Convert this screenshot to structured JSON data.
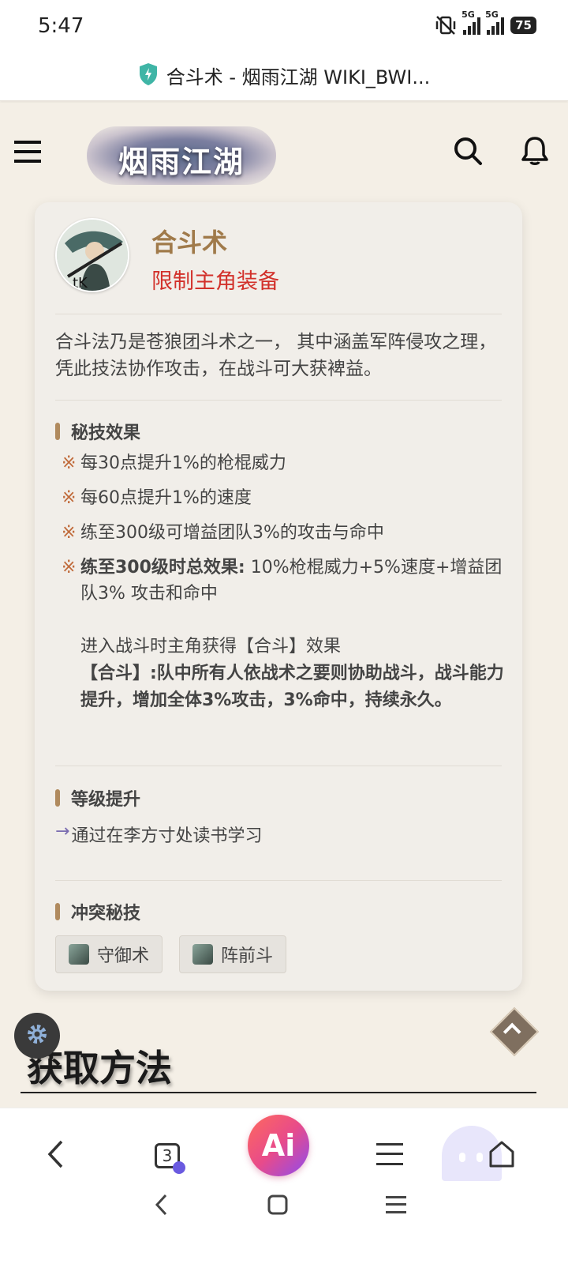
{
  "status_bar": {
    "time": "5:47",
    "net1": "5G",
    "net2": "5G",
    "battery": "75"
  },
  "url_bar": {
    "title": "合斗术 - 烟雨江湖 WIKI_BWI..."
  },
  "header": {
    "logo_text": "烟雨江湖"
  },
  "card": {
    "title": "合斗术",
    "restriction": "限制主角装备",
    "avatar_caption": "tK",
    "description": "合斗法乃是苍狼团斗术之一， 其中涵盖军阵侵攻之理，凭此技法协作攻击，在战斗可大获裨益。",
    "effects_heading": "秘技效果",
    "mark": "※",
    "effects": [
      "每30点提升1%的枪棍威力",
      "每60点提升1%的速度",
      "练至300级可增益团队3%的攻击与命中"
    ],
    "total_effect_label": "练至300级时总效果:",
    "total_effect_value": " 10%枪棍威力+5%速度+增益团队3% 攻击和命中",
    "battle_note": "进入战斗时主角获得【合斗】效果",
    "heji_bold": "【合斗】:队中所有人依战术之要则协助战斗，战斗能力提升，增加全体3%攻击，3%命中，持续永久。",
    "level_heading": "等级提升",
    "arrow": "→",
    "level_text": "通过在李方寸处读书学习",
    "conflict_heading": "冲突秘技",
    "conflicts": [
      "守御术",
      "阵前斗"
    ]
  },
  "section_heading": "获取方法",
  "browser_nav": {
    "tabs_count": "3",
    "ai_label": "Ai"
  },
  "colors": {
    "title_brown": "#a07a4a",
    "restrict_red": "#d2302a",
    "accent_bar": "#b08a5e"
  }
}
